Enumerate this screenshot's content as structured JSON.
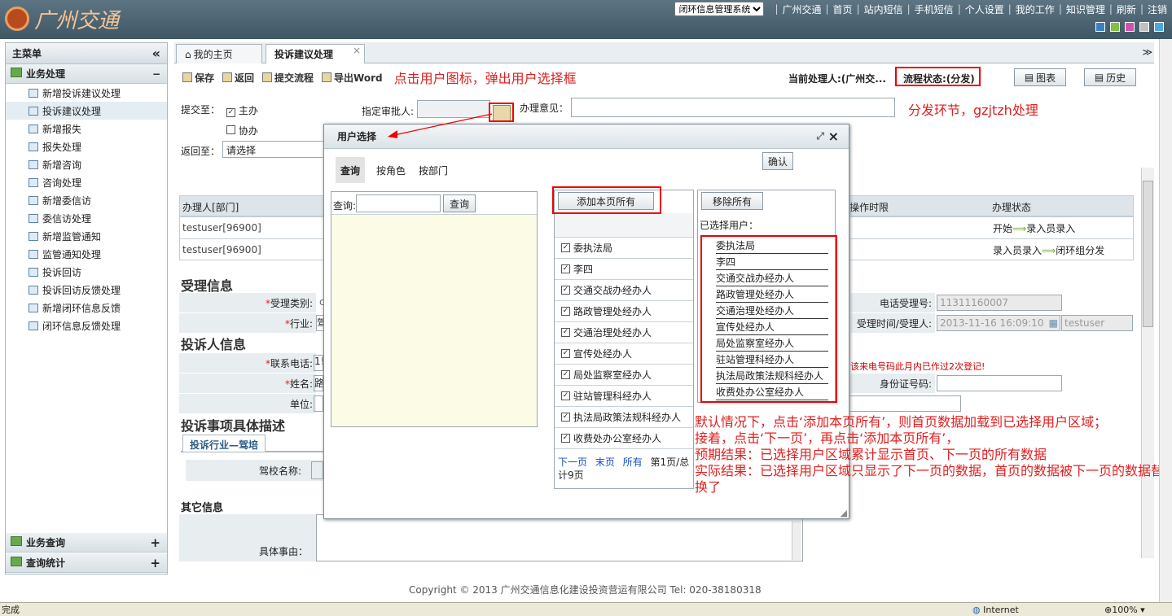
{
  "header": {
    "logo": "广州交通",
    "system_select": "闭环信息管理系统",
    "nav": [
      "广州交通",
      "首页",
      "站内短信",
      "手机短信",
      "个人设置",
      "我的工作",
      "知识管理",
      "刷新",
      "注销"
    ],
    "skins": [
      "#3a7fc4",
      "#7dc242",
      "#d050b0",
      "#c0c0c0",
      "#4aa8e0"
    ]
  },
  "sidebar": {
    "title": "主菜单",
    "collapse_icon": "«",
    "group1": "业务处理",
    "group1_toggle": "−",
    "items": [
      "新增投诉建议处理",
      "投诉建议处理",
      "新增报失",
      "报失处理",
      "新增咨询",
      "咨询处理",
      "新增委信访",
      "委信访处理",
      "新增监管通知",
      "监管通知处理",
      "投诉回访",
      "投诉回访反馈处理",
      "新增闭环信息反馈",
      "闭环信息反馈处理"
    ],
    "group2": "业务查询",
    "group3": "查询统计",
    "toggle_plus": "+"
  },
  "tabs": {
    "home": "我的主页",
    "active": "投诉建议处理",
    "close": "×",
    "more": "≫"
  },
  "toolbar": {
    "save": "保存",
    "back": "返回",
    "submit": "提交流程",
    "export": "导出Word",
    "annotation": "点击用户图标，弹出用户选择框",
    "current_handler": "当前处理人:(广州交...",
    "flow_state": "流程状态:(分发)",
    "chart": "图表",
    "history": "历史"
  },
  "form": {
    "submit_to": "提交至：",
    "main": "主办",
    "assist": "协办",
    "approver": "指定审批人:",
    "opinion": "办理意见：",
    "return_to": "返回至：",
    "return_select": "请选择",
    "note": "分发环节，gzjtzh处理"
  },
  "grid": {
    "h_handler": "办理人[部门]",
    "h_limit": "操作时限",
    "h_state": "办理状态",
    "rows": [
      {
        "handler": "testuser[96900]",
        "state_a": "开始",
        "state_b": "录入员录入"
      },
      {
        "handler": "testuser[96900]",
        "state_a": "录入员录入",
        "state_b": "闭环组分发"
      }
    ]
  },
  "detail": {
    "sec1": "受理信息",
    "type": "受理类别:",
    "industry": "行业:",
    "sec2": "投诉人信息",
    "phone": "联系电话:",
    "name": "姓名:",
    "unit": "单位:",
    "sec3": "投诉事项具体描述",
    "sub_tab": "投诉行业—驾培",
    "school": "驾校名称:",
    "sec4": "其它信息",
    "reason": "具体事由：",
    "r_phone_lbl": "电话受理号:",
    "r_phone": "11311160007",
    "r_time_lbl": "受理时间/受理人:",
    "r_time": "2013-11-16 16:09:10",
    "r_user": "testuser",
    "r_warn": "该来电号码此月内已作过2次登记!",
    "r_id": "身份证号码:",
    "phone_partial": "1!",
    "name_partial": "路",
    "type_partial": "c",
    "industry_partial": "驾"
  },
  "dialog": {
    "title": "用户选择",
    "popout": "⤢",
    "close": "×",
    "tabs": [
      "查询",
      "按角色",
      "按部门"
    ],
    "confirm": "确认",
    "query_label": "查询:",
    "query_btn": "查询",
    "add_all": "添加本页所有",
    "remove_all": "移除所有",
    "selected_label": "已选择用户：",
    "users": [
      "委执法局",
      "李四",
      "交通交战办经办人",
      "路政管理处经办人",
      "交通治理处经办人",
      "宣传处经办人",
      "局处监察室经办人",
      "驻站管理科经办人",
      "执法局政策法规科经办人",
      "收费处办公室经办人"
    ],
    "pager": {
      "next": "下一页",
      "last": "末页",
      "all": "所有",
      "info": "第1页/总计9页"
    }
  },
  "annotation_text": [
    "默认情况下，点击‘添加本页所有’，则首页数据加载到已选择用户区域；",
    "接着，点击‘下一页’，再点击‘添加本页所有’，",
    "预期结果：已选择用户区域累计显示首页、下一页的所有数据",
    "实际结果：已选择用户区域只显示了下一页的数据，首页的数据被下一页的数据替换了"
  ],
  "footer": "Copyright © 2013 广州交通信息化建设投资营运有限公司  Tel: 020-38180318",
  "status": {
    "left": "完成",
    "zone": "Internet",
    "zoom": "100%"
  }
}
